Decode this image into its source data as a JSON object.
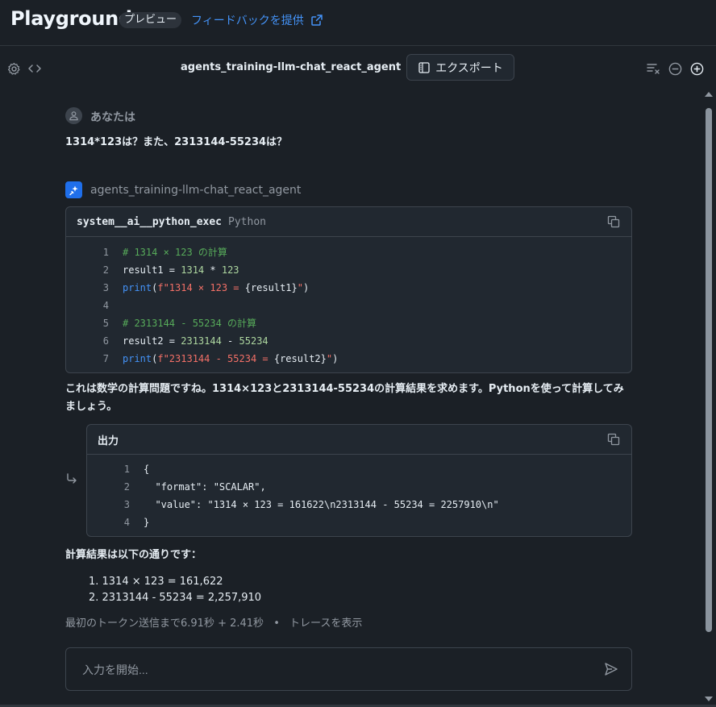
{
  "header": {
    "title": "Playground",
    "badge": "プレビュー",
    "feedback_link": "フィードバックを提供"
  },
  "toolbar": {
    "model_name": "agents_training-llm-chat_react_agent",
    "export_label": "エクスポート"
  },
  "conversation": {
    "user": {
      "name": "あなたは",
      "message": "1314*123は？また、2313144-55234は？"
    },
    "agent": {
      "name": "agents_training-llm-chat_react_agent",
      "tool_call": {
        "tool_name": "system__ai__python_exec",
        "language": "Python",
        "lines": [
          {
            "num": "1",
            "parts": [
              {
                "t": "# 1314 × 123 の計算",
                "c": "comment"
              }
            ]
          },
          {
            "num": "2",
            "parts": [
              {
                "t": "result1 = ",
                "c": "plain"
              },
              {
                "t": "1314",
                "c": "num"
              },
              {
                "t": " * ",
                "c": "plain"
              },
              {
                "t": "123",
                "c": "num"
              }
            ]
          },
          {
            "num": "3",
            "parts": [
              {
                "t": "print",
                "c": "fn"
              },
              {
                "t": "(",
                "c": "plain"
              },
              {
                "t": "f\"1314 × 123 = ",
                "c": "str"
              },
              {
                "t": "{result1}",
                "c": "plain"
              },
              {
                "t": "\"",
                "c": "str"
              },
              {
                "t": ")",
                "c": "plain"
              }
            ]
          },
          {
            "num": "4",
            "parts": []
          },
          {
            "num": "5",
            "parts": [
              {
                "t": "# 2313144 - 55234 の計算",
                "c": "comment"
              }
            ]
          },
          {
            "num": "6",
            "parts": [
              {
                "t": "result2 = ",
                "c": "plain"
              },
              {
                "t": "2313144",
                "c": "num"
              },
              {
                "t": " - ",
                "c": "plain"
              },
              {
                "t": "55234",
                "c": "num"
              }
            ]
          },
          {
            "num": "7",
            "parts": [
              {
                "t": "print",
                "c": "fn"
              },
              {
                "t": "(",
                "c": "plain"
              },
              {
                "t": "f\"2313144 - 55234 = ",
                "c": "str"
              },
              {
                "t": "{result2}",
                "c": "plain"
              },
              {
                "t": "\"",
                "c": "str"
              },
              {
                "t": ")",
                "c": "plain"
              }
            ]
          }
        ]
      },
      "reasoning": "これは数学の計算問題ですね。1314×123と2313144-55234の計算結果を求めます。Pythonを使って計算してみましょう。",
      "output": {
        "title": "出力",
        "lines": [
          {
            "num": "1",
            "text": "{"
          },
          {
            "num": "2",
            "text": "  \"format\": \"SCALAR\","
          },
          {
            "num": "3",
            "text": "  \"value\": \"1314 × 123 = 161622\\n2313144 - 55234 = 2257910\\n\""
          },
          {
            "num": "4",
            "text": "}"
          }
        ]
      },
      "result_heading": "計算結果は以下の通りです：",
      "results": [
        "1. 1314 × 123 = 161,622",
        "2. 2313144 - 55234 = 2,257,910"
      ],
      "timing": "最初のトークン送信まで6.91秒 + 2.41秒",
      "separator": "•",
      "trace_link": "トレースを表示"
    }
  },
  "input": {
    "placeholder": "入力を開始..."
  },
  "icons": {
    "settings": "gear-icon",
    "code": "code-icon",
    "clear": "clear-chat-icon",
    "minus": "minus-circle-icon",
    "plus": "plus-circle-icon",
    "copy": "copy-icon",
    "send": "send-icon",
    "external": "external-link-icon"
  },
  "colors": {
    "background": "#1b2026",
    "accent": "#4493f8",
    "agent_avatar": "#1f6feb"
  }
}
